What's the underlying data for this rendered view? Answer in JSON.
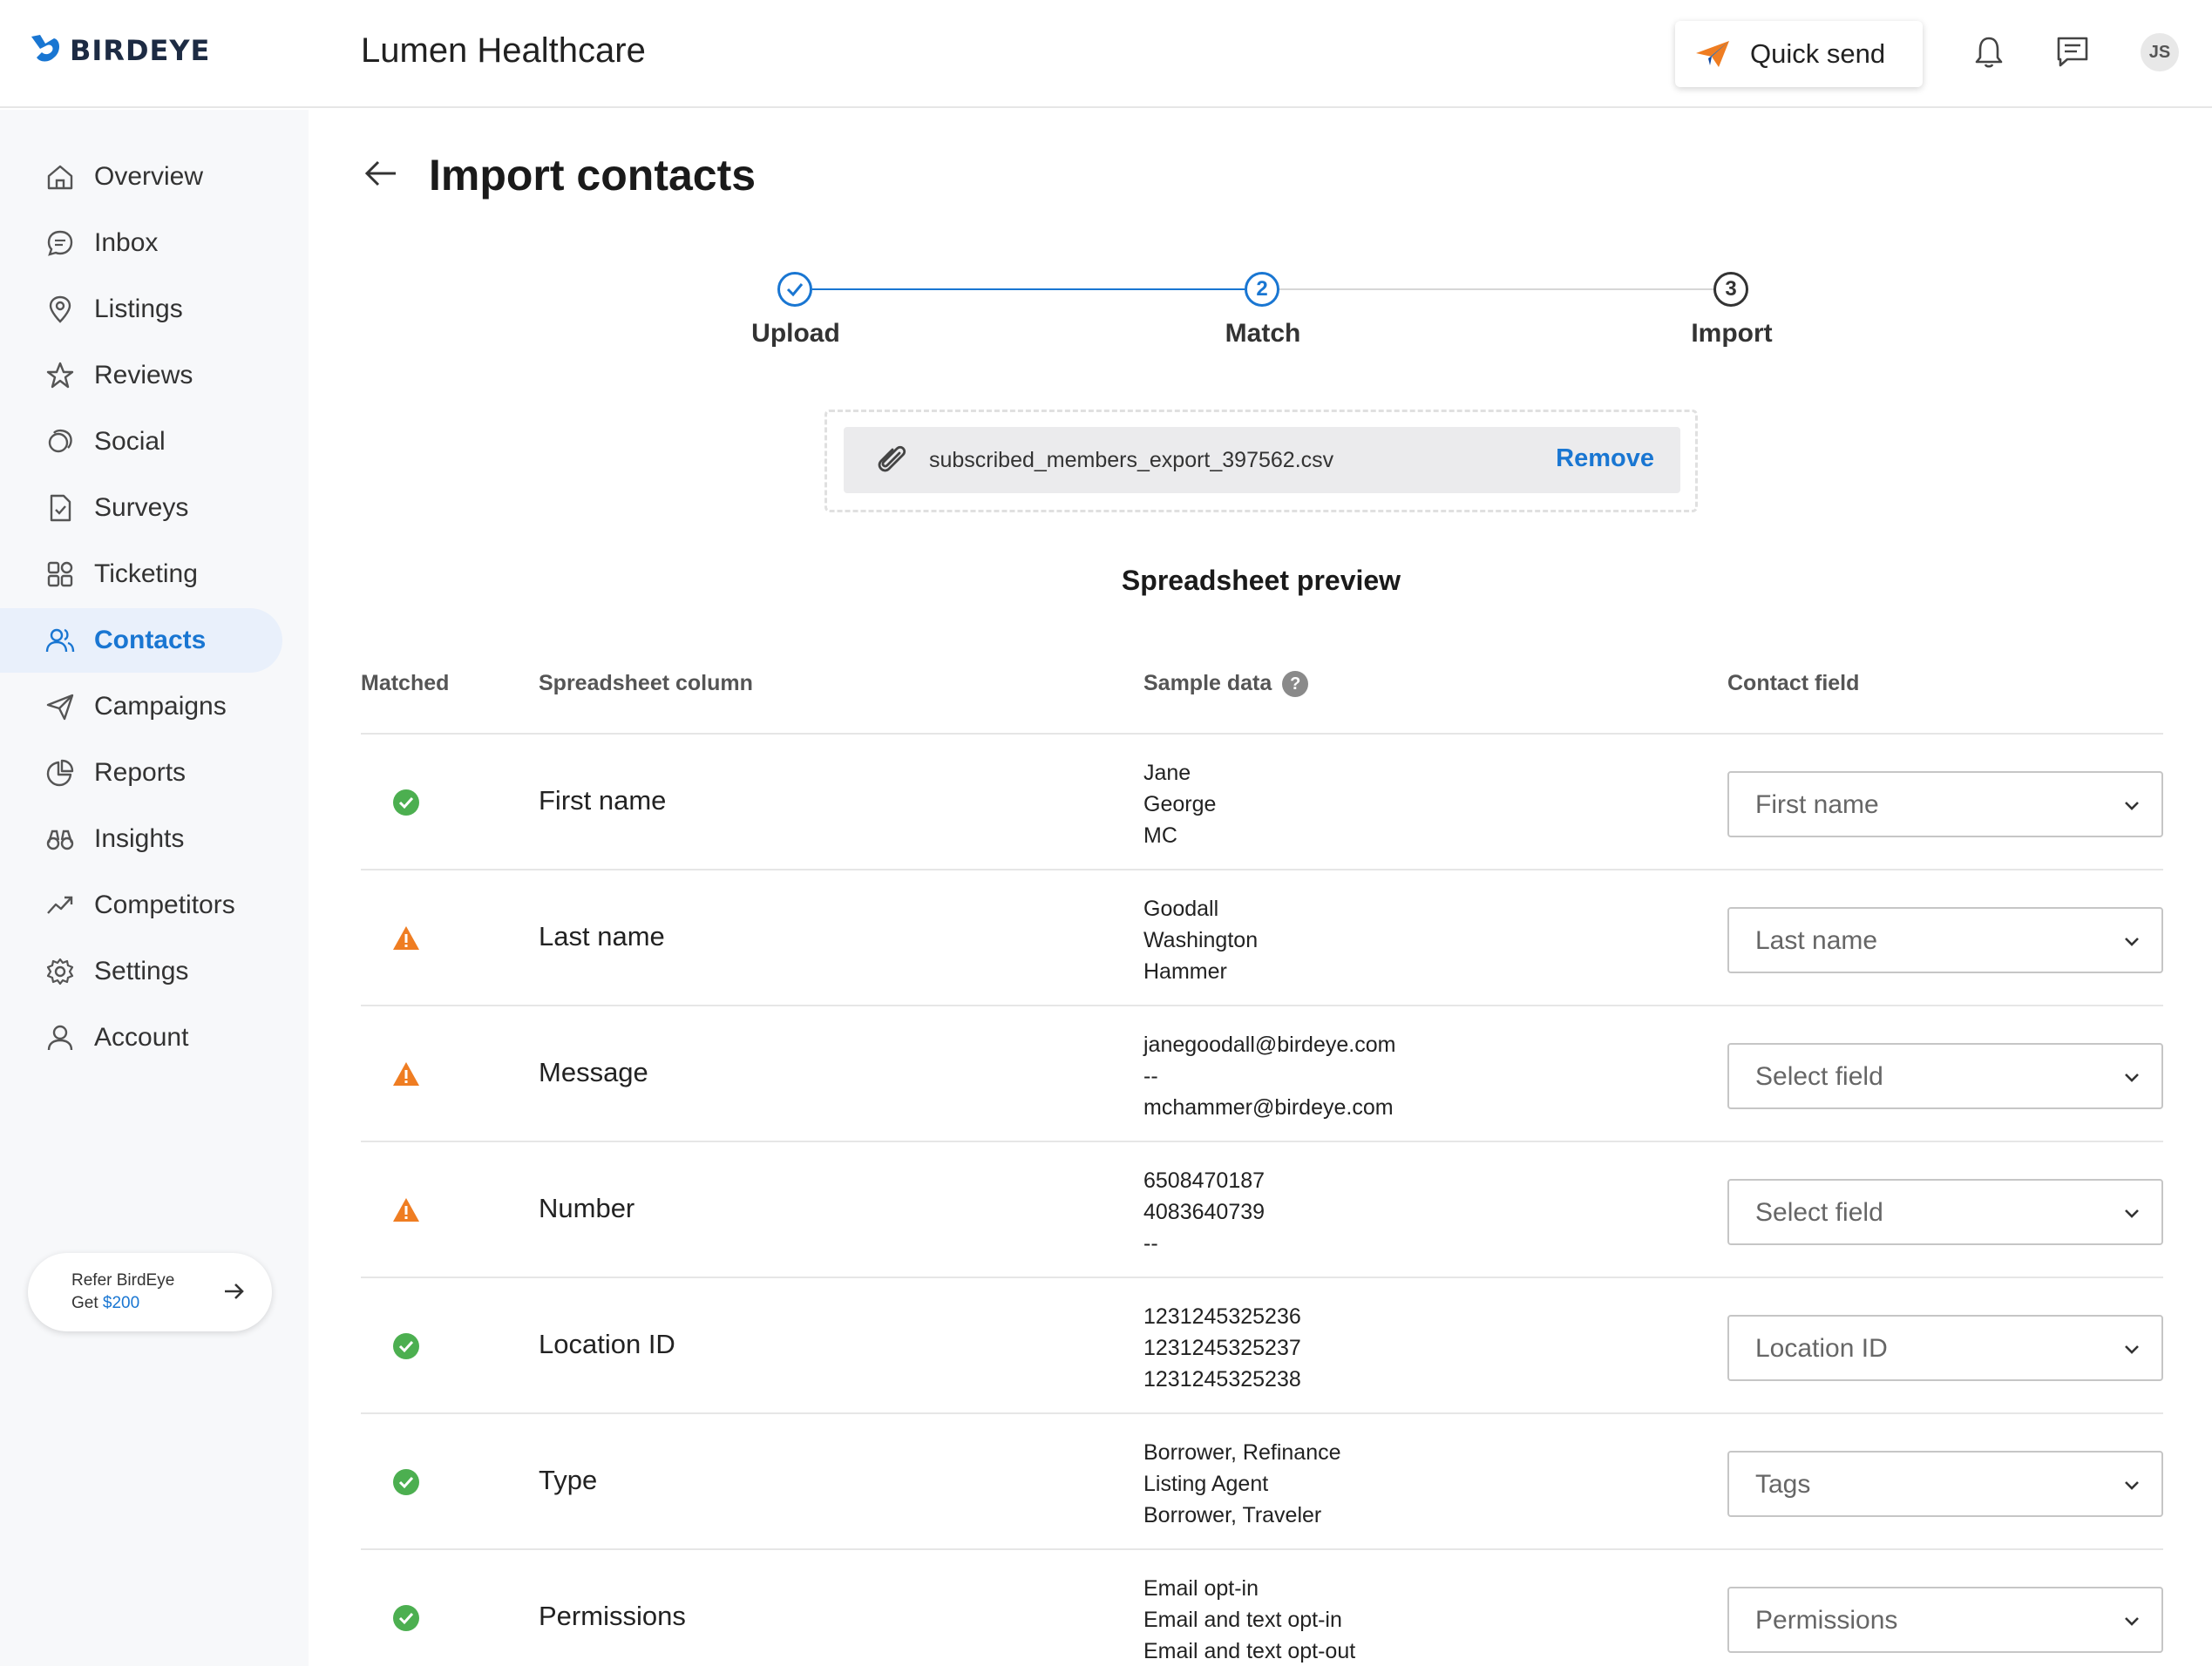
{
  "header": {
    "logo_text": "BIRDEYE",
    "business_name": "Lumen Healthcare",
    "quick_send_label": "Quick send",
    "avatar_initials": "JS"
  },
  "sidebar": {
    "items": [
      {
        "label": "Overview",
        "icon": "home-icon",
        "active": false
      },
      {
        "label": "Inbox",
        "icon": "chat-icon",
        "active": false
      },
      {
        "label": "Listings",
        "icon": "location-pin-icon",
        "active": false
      },
      {
        "label": "Reviews",
        "icon": "star-icon",
        "active": false
      },
      {
        "label": "Social",
        "icon": "social-icon",
        "active": false
      },
      {
        "label": "Surveys",
        "icon": "survey-icon",
        "active": false
      },
      {
        "label": "Ticketing",
        "icon": "grid-icon",
        "active": false
      },
      {
        "label": "Contacts",
        "icon": "contacts-icon",
        "active": true
      },
      {
        "label": "Campaigns",
        "icon": "send-icon",
        "active": false
      },
      {
        "label": "Reports",
        "icon": "pie-chart-icon",
        "active": false
      },
      {
        "label": "Insights",
        "icon": "binoculars-icon",
        "active": false
      },
      {
        "label": "Competitors",
        "icon": "trend-icon",
        "active": false
      },
      {
        "label": "Settings",
        "icon": "gear-icon",
        "active": false
      },
      {
        "label": "Account",
        "icon": "user-icon",
        "active": false
      }
    ],
    "refer": {
      "line1": "Refer BirdEye",
      "line2_prefix": "Get ",
      "amount": "$200"
    }
  },
  "page": {
    "title": "Import contacts",
    "steps": [
      {
        "number": "1",
        "label": "Upload",
        "state": "done"
      },
      {
        "number": "2",
        "label": "Match",
        "state": "current"
      },
      {
        "number": "3",
        "label": "Import",
        "state": "pending"
      }
    ],
    "file": {
      "name": "subscribed_members_export_397562.csv",
      "remove_label": "Remove"
    },
    "preview_title": "Spreadsheet preview",
    "table": {
      "headers": {
        "matched": "Matched",
        "column": "Spreadsheet column",
        "sample": "Sample data",
        "field": "Contact field"
      },
      "rows": [
        {
          "status": "matched",
          "column": "First name",
          "sample": [
            "Jane",
            "George",
            "MC"
          ],
          "field": "First name"
        },
        {
          "status": "warning",
          "column": "Last name",
          "sample": [
            "Goodall",
            "Washington",
            "Hammer"
          ],
          "field": "Last name"
        },
        {
          "status": "warning",
          "column": "Message",
          "sample": [
            "janegoodall@birdeye.com",
            "--",
            "mchammer@birdeye.com"
          ],
          "field": "Select field"
        },
        {
          "status": "warning",
          "column": "Number",
          "sample": [
            "6508470187",
            "4083640739",
            "--"
          ],
          "field": "Select field"
        },
        {
          "status": "matched",
          "column": "Location ID",
          "sample": [
            "1231245325236",
            "1231245325237",
            "1231245325238"
          ],
          "field": "Location ID"
        },
        {
          "status": "matched",
          "column": "Type",
          "sample": [
            "Borrower, Refinance",
            "Listing Agent",
            "Borrower, Traveler"
          ],
          "field": "Tags"
        },
        {
          "status": "matched",
          "column": "Permissions",
          "sample": [
            "Email opt-in",
            "Email and text opt-in",
            "Email and text opt-out"
          ],
          "field": "Permissions"
        }
      ]
    }
  },
  "colors": {
    "accent": "#1976d2",
    "success": "#4caf50",
    "warning": "#ef7d22",
    "active_bg": "#e9f0fb"
  }
}
